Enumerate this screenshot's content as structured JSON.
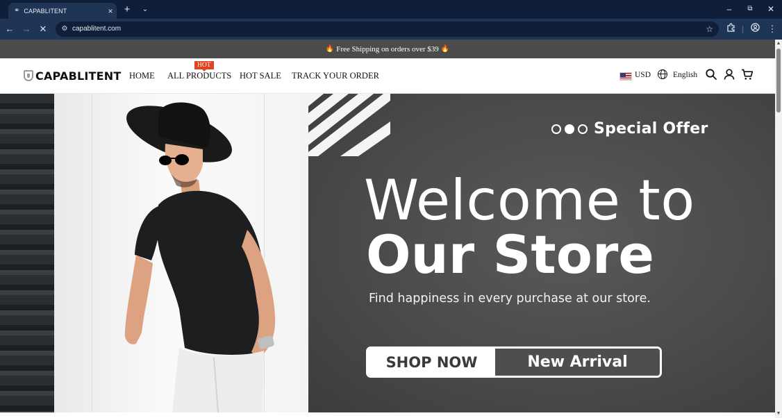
{
  "browser": {
    "tab_title": "CAPABLITENT",
    "url": "capablitent.com",
    "icons": [
      "favicon-icon",
      "close-tab-icon",
      "new-tab-icon",
      "tab-list-icon",
      "minimize-icon",
      "restore-icon",
      "close-window-icon",
      "back-icon",
      "forward-icon",
      "stop-loading-icon",
      "site-info-icon",
      "bookmark-star-icon",
      "extensions-icon",
      "profile-icon",
      "browser-menu-icon"
    ]
  },
  "announcement": {
    "text": "Free Shipping on orders over $39",
    "icon": "flame-icon"
  },
  "header": {
    "logo_text": "CAPABLITENT",
    "nav": [
      {
        "label": "HOME"
      },
      {
        "label": "ALL PRODUCTS",
        "badge": "HOT"
      },
      {
        "label": "HOT SALE"
      },
      {
        "label": "TRACK YOUR ORDER"
      }
    ],
    "currency": "USD",
    "language": "English",
    "icons": [
      "us-flag-icon",
      "globe-icon",
      "search-icon",
      "account-icon",
      "cart-icon"
    ]
  },
  "hero": {
    "eyebrow": "Special Offer",
    "headline_line1": "Welcome to",
    "headline_line2": "Our Store",
    "tagline": "Find happiness in every purchase at our store.",
    "primary_button": "SHOP NOW",
    "secondary_button": "New Arrival",
    "slider_dots": 3,
    "active_dot": 2
  },
  "colors": {
    "browser_frame": "#0f1f3a",
    "announcement_bg": "#4b4b4b",
    "hot_badge": "#e0431f",
    "hero_dark": "#4a4a4a",
    "text_dark": "#111111"
  }
}
